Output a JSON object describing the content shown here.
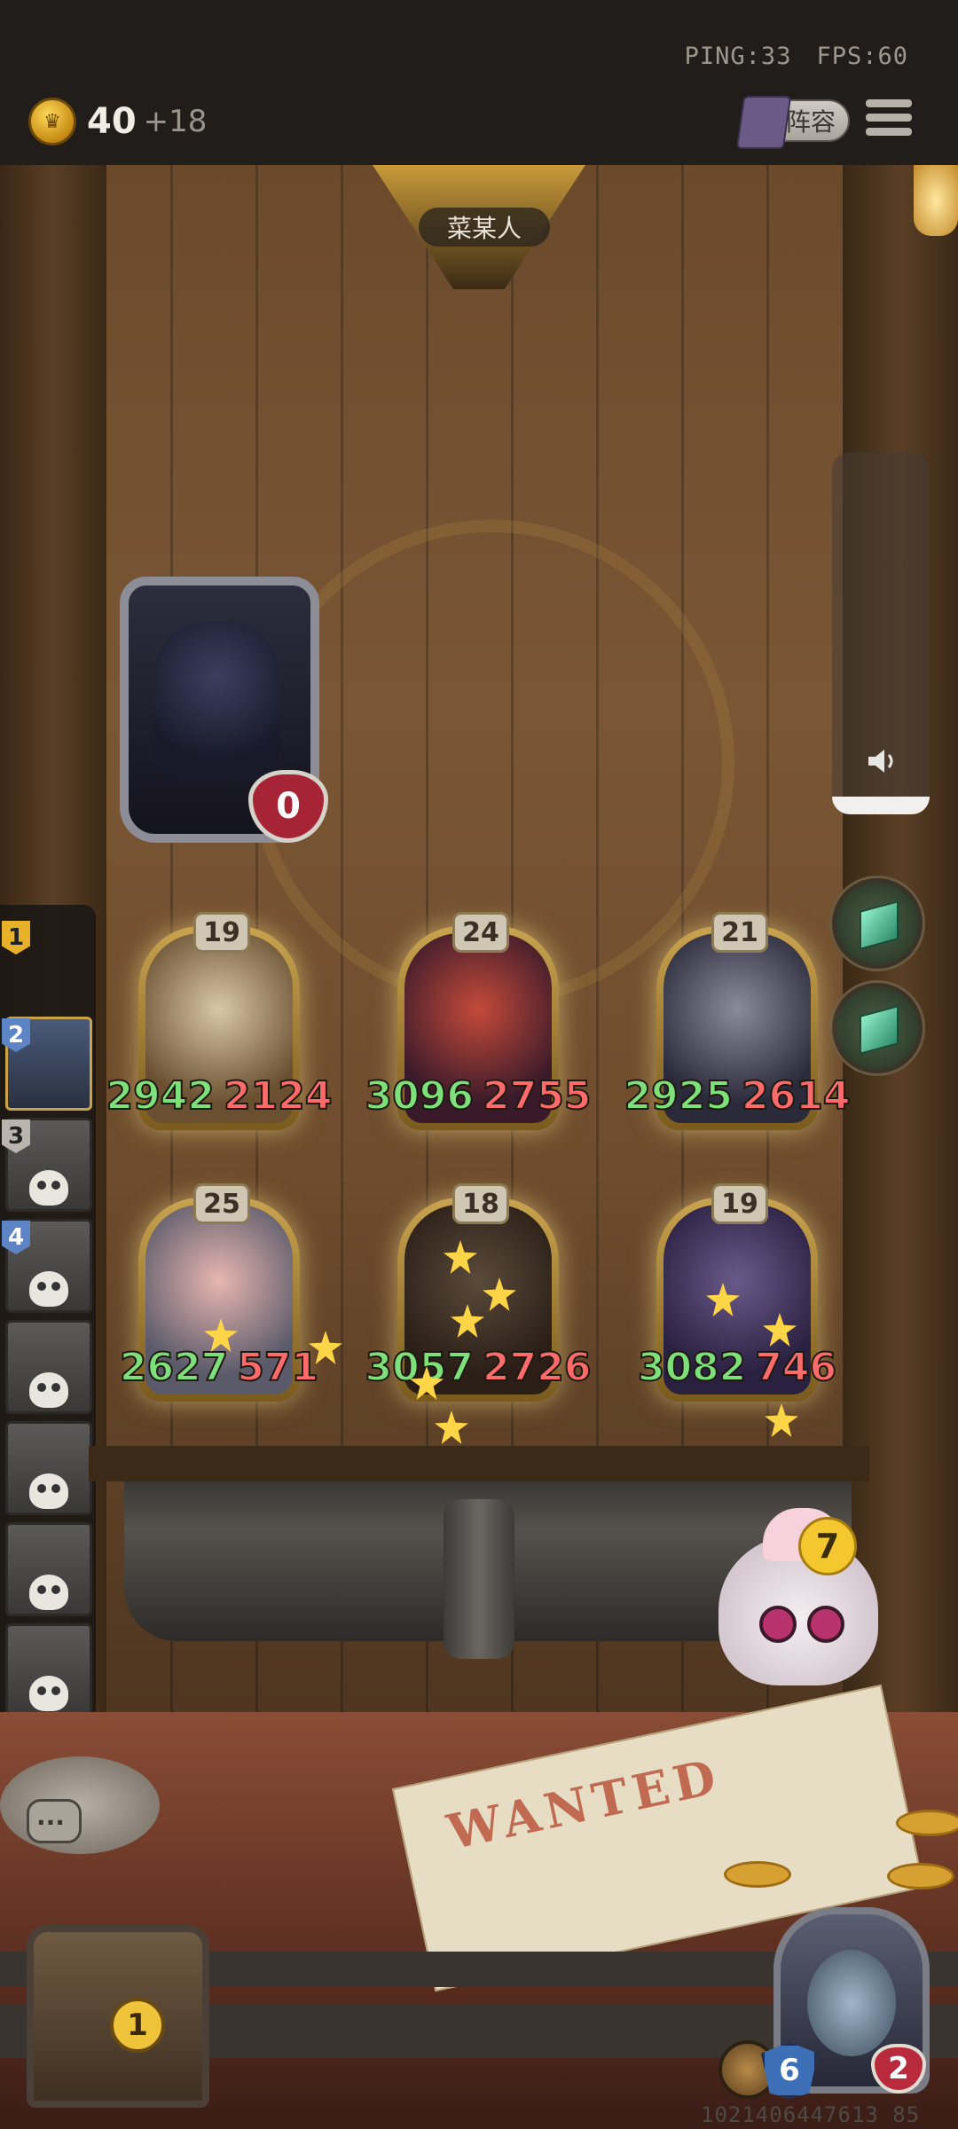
{
  "header": {
    "ping": "PING:33",
    "fps": "FPS:60",
    "gold": "40",
    "gold_income": "+18",
    "lineup_label": "阵容"
  },
  "opponent": {
    "name": "菜某人",
    "health": "0"
  },
  "sidebar": {
    "ranks": [
      "1",
      "2",
      "3",
      "4"
    ],
    "slot_count": 7
  },
  "board": {
    "row1": [
      {
        "level": "19",
        "attack": "2942",
        "health": "2124"
      },
      {
        "level": "24",
        "attack": "3096",
        "health": "2755"
      },
      {
        "level": "21",
        "attack": "2925",
        "health": "2614"
      }
    ],
    "row2": [
      {
        "level": "25",
        "attack": "2627",
        "health": "571"
      },
      {
        "level": "18",
        "attack": "3057",
        "health": "2726"
      },
      {
        "level": "19",
        "attack": "3082",
        "health": "746"
      }
    ]
  },
  "mascot": {
    "count": "7"
  },
  "table": {
    "poster_title": "WANTED"
  },
  "shop": {
    "level": "1"
  },
  "hero": {
    "armor": "6",
    "health": "2"
  },
  "footer": {
    "id": "1021406447613 85"
  },
  "colors": {
    "attack": "#7ee07a",
    "health": "#ff6a6a",
    "gold": "#f0c43a"
  },
  "icons": {
    "coin": "crown-coin-icon",
    "menu": "hamburger-menu-icon",
    "volume": "speaker-icon",
    "gem": "emerald-gem-icon",
    "chat": "chat-bubble-icon"
  }
}
